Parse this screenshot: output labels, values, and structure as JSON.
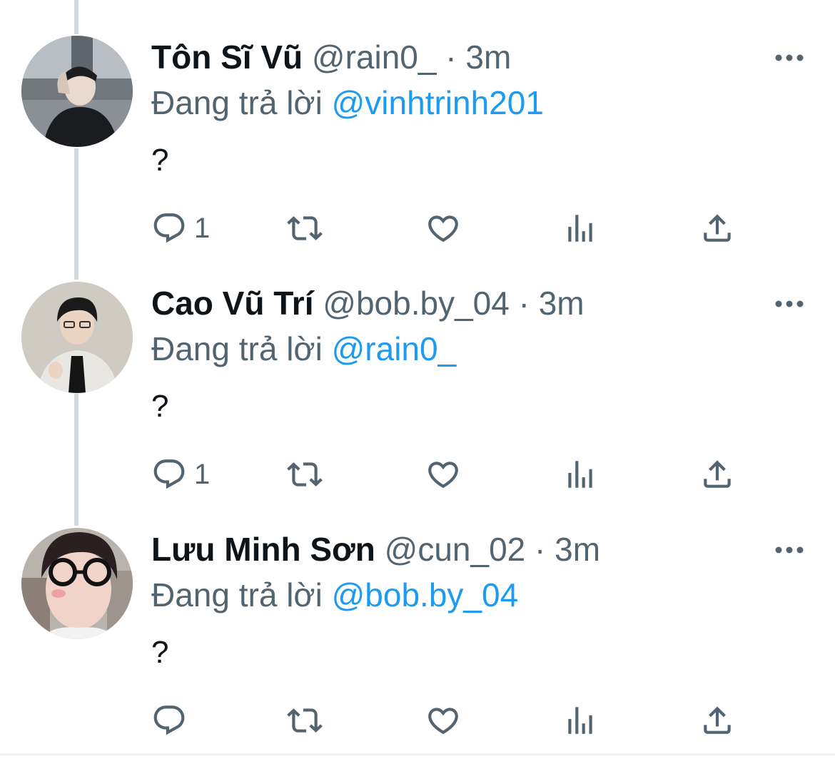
{
  "colors": {
    "text": "#0f1419",
    "secondary": "#536471",
    "link": "#1d9bf0",
    "thread_line": "#cfd9de"
  },
  "reply_prefix": "Đang trả lời",
  "tweets": [
    {
      "name": "Tôn Sĩ Vũ",
      "handle": "@rain0_",
      "separator": "·",
      "time": "3m",
      "reply_to": "@vinhtrinh201",
      "text": "?",
      "reply_count": "1",
      "avatar_icon": "avatar-photo"
    },
    {
      "name": "Cao Vũ Trí",
      "handle": "@bob.by_04",
      "separator": "·",
      "time": "3m",
      "reply_to": "@rain0_",
      "text": "?",
      "reply_count": "1",
      "avatar_icon": "avatar-photo"
    },
    {
      "name": "Lưu Minh Sơn",
      "handle": "@cun_02",
      "separator": "·",
      "time": "3m",
      "reply_to": "@bob.by_04",
      "text": "?",
      "reply_count": "",
      "avatar_icon": "avatar-photo"
    }
  ],
  "action_icons": [
    "reply-icon",
    "retweet-icon",
    "like-icon",
    "views-icon",
    "share-icon"
  ]
}
